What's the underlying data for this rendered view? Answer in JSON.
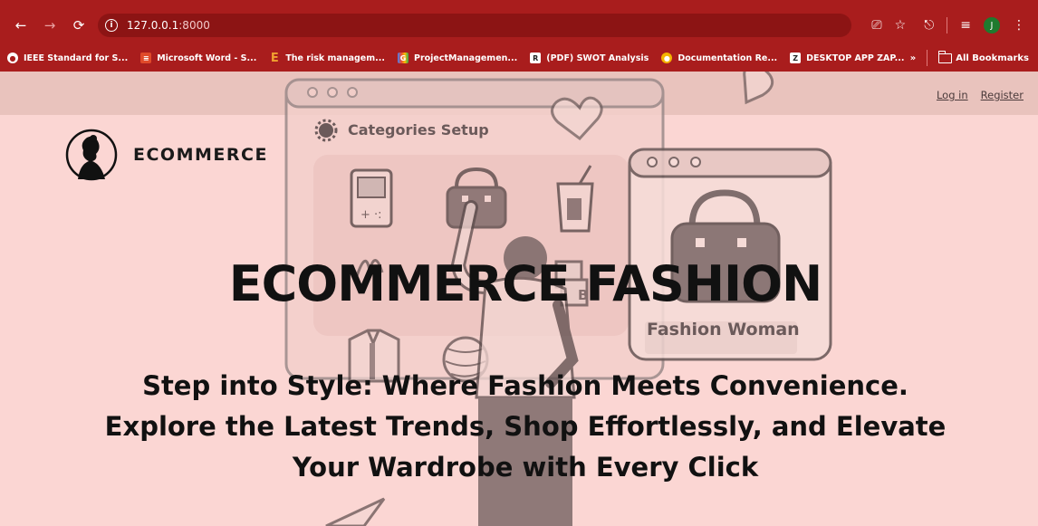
{
  "browser": {
    "url_host": "127.0.0.1",
    "url_port": ":8000",
    "profile_initial": "J",
    "bookmarks": [
      {
        "label": "IEEE Standard for S...",
        "icon": "globe-icon",
        "color": "#ffffff"
      },
      {
        "label": "Microsoft Word - S...",
        "icon": "pdf-icon",
        "color": "#e04a2a"
      },
      {
        "label": "The risk managem...",
        "icon": "e-icon",
        "color": "#f0a030"
      },
      {
        "label": "ProjectManagemen...",
        "icon": "google-icon",
        "color": "#ea4335"
      },
      {
        "label": "(PDF) SWOT Analysis",
        "icon": "researchgate-icon",
        "color": "#ffffff"
      },
      {
        "label": "Documentation Re...",
        "icon": "chrome-icon",
        "color": "#f4b400"
      },
      {
        "label": "DESKTOP APP ZAP...",
        "icon": "z-icon",
        "color": "#ffffff"
      }
    ],
    "overflow_label": "»",
    "all_bookmarks_label": "All Bookmarks"
  },
  "header": {
    "login_label": "Log in",
    "register_label": "Register"
  },
  "brand": {
    "name": "ECOMMERCE"
  },
  "illustration": {
    "panel_title": "Categories Setup",
    "card_label": "Fashion Woman"
  },
  "hero": {
    "title": "ECOMMERCE FASHION",
    "subtitle_line1": "Step into Style: Where Fashion Meets Convenience.",
    "subtitle_line2": "Explore the Latest Trends, Shop Effortlessly, and Elevate",
    "subtitle_line3": "Your Wardrobe with Every Click"
  },
  "colors": {
    "chrome": "#a91d1d",
    "page_background": "#fbd6d3",
    "header_band": "#e9c3bd",
    "text": "#111111"
  }
}
